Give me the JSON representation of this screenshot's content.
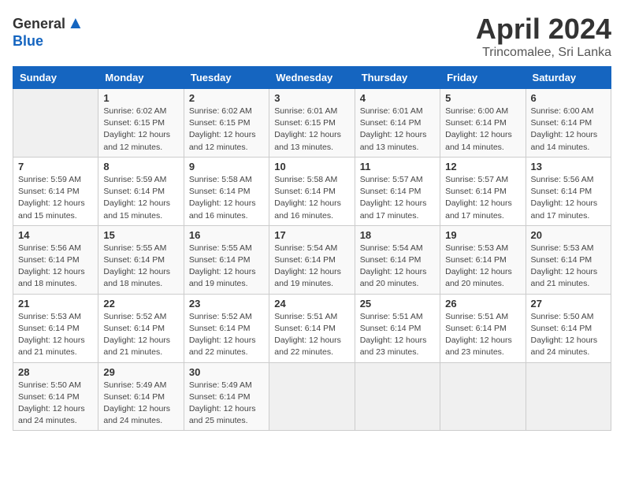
{
  "header": {
    "logo_general": "General",
    "logo_blue": "Blue",
    "title": "April 2024",
    "location": "Trincomalee, Sri Lanka"
  },
  "days_of_week": [
    "Sunday",
    "Monday",
    "Tuesday",
    "Wednesday",
    "Thursday",
    "Friday",
    "Saturday"
  ],
  "weeks": [
    [
      {
        "day": "",
        "info": ""
      },
      {
        "day": "1",
        "info": "Sunrise: 6:02 AM\nSunset: 6:15 PM\nDaylight: 12 hours\nand 12 minutes."
      },
      {
        "day": "2",
        "info": "Sunrise: 6:02 AM\nSunset: 6:15 PM\nDaylight: 12 hours\nand 12 minutes."
      },
      {
        "day": "3",
        "info": "Sunrise: 6:01 AM\nSunset: 6:15 PM\nDaylight: 12 hours\nand 13 minutes."
      },
      {
        "day": "4",
        "info": "Sunrise: 6:01 AM\nSunset: 6:14 PM\nDaylight: 12 hours\nand 13 minutes."
      },
      {
        "day": "5",
        "info": "Sunrise: 6:00 AM\nSunset: 6:14 PM\nDaylight: 12 hours\nand 14 minutes."
      },
      {
        "day": "6",
        "info": "Sunrise: 6:00 AM\nSunset: 6:14 PM\nDaylight: 12 hours\nand 14 minutes."
      }
    ],
    [
      {
        "day": "7",
        "info": "Sunrise: 5:59 AM\nSunset: 6:14 PM\nDaylight: 12 hours\nand 15 minutes."
      },
      {
        "day": "8",
        "info": "Sunrise: 5:59 AM\nSunset: 6:14 PM\nDaylight: 12 hours\nand 15 minutes."
      },
      {
        "day": "9",
        "info": "Sunrise: 5:58 AM\nSunset: 6:14 PM\nDaylight: 12 hours\nand 16 minutes."
      },
      {
        "day": "10",
        "info": "Sunrise: 5:58 AM\nSunset: 6:14 PM\nDaylight: 12 hours\nand 16 minutes."
      },
      {
        "day": "11",
        "info": "Sunrise: 5:57 AM\nSunset: 6:14 PM\nDaylight: 12 hours\nand 17 minutes."
      },
      {
        "day": "12",
        "info": "Sunrise: 5:57 AM\nSunset: 6:14 PM\nDaylight: 12 hours\nand 17 minutes."
      },
      {
        "day": "13",
        "info": "Sunrise: 5:56 AM\nSunset: 6:14 PM\nDaylight: 12 hours\nand 17 minutes."
      }
    ],
    [
      {
        "day": "14",
        "info": "Sunrise: 5:56 AM\nSunset: 6:14 PM\nDaylight: 12 hours\nand 18 minutes."
      },
      {
        "day": "15",
        "info": "Sunrise: 5:55 AM\nSunset: 6:14 PM\nDaylight: 12 hours\nand 18 minutes."
      },
      {
        "day": "16",
        "info": "Sunrise: 5:55 AM\nSunset: 6:14 PM\nDaylight: 12 hours\nand 19 minutes."
      },
      {
        "day": "17",
        "info": "Sunrise: 5:54 AM\nSunset: 6:14 PM\nDaylight: 12 hours\nand 19 minutes."
      },
      {
        "day": "18",
        "info": "Sunrise: 5:54 AM\nSunset: 6:14 PM\nDaylight: 12 hours\nand 20 minutes."
      },
      {
        "day": "19",
        "info": "Sunrise: 5:53 AM\nSunset: 6:14 PM\nDaylight: 12 hours\nand 20 minutes."
      },
      {
        "day": "20",
        "info": "Sunrise: 5:53 AM\nSunset: 6:14 PM\nDaylight: 12 hours\nand 21 minutes."
      }
    ],
    [
      {
        "day": "21",
        "info": "Sunrise: 5:53 AM\nSunset: 6:14 PM\nDaylight: 12 hours\nand 21 minutes."
      },
      {
        "day": "22",
        "info": "Sunrise: 5:52 AM\nSunset: 6:14 PM\nDaylight: 12 hours\nand 21 minutes."
      },
      {
        "day": "23",
        "info": "Sunrise: 5:52 AM\nSunset: 6:14 PM\nDaylight: 12 hours\nand 22 minutes."
      },
      {
        "day": "24",
        "info": "Sunrise: 5:51 AM\nSunset: 6:14 PM\nDaylight: 12 hours\nand 22 minutes."
      },
      {
        "day": "25",
        "info": "Sunrise: 5:51 AM\nSunset: 6:14 PM\nDaylight: 12 hours\nand 23 minutes."
      },
      {
        "day": "26",
        "info": "Sunrise: 5:51 AM\nSunset: 6:14 PM\nDaylight: 12 hours\nand 23 minutes."
      },
      {
        "day": "27",
        "info": "Sunrise: 5:50 AM\nSunset: 6:14 PM\nDaylight: 12 hours\nand 24 minutes."
      }
    ],
    [
      {
        "day": "28",
        "info": "Sunrise: 5:50 AM\nSunset: 6:14 PM\nDaylight: 12 hours\nand 24 minutes."
      },
      {
        "day": "29",
        "info": "Sunrise: 5:49 AM\nSunset: 6:14 PM\nDaylight: 12 hours\nand 24 minutes."
      },
      {
        "day": "30",
        "info": "Sunrise: 5:49 AM\nSunset: 6:14 PM\nDaylight: 12 hours\nand 25 minutes."
      },
      {
        "day": "",
        "info": ""
      },
      {
        "day": "",
        "info": ""
      },
      {
        "day": "",
        "info": ""
      },
      {
        "day": "",
        "info": ""
      }
    ]
  ]
}
